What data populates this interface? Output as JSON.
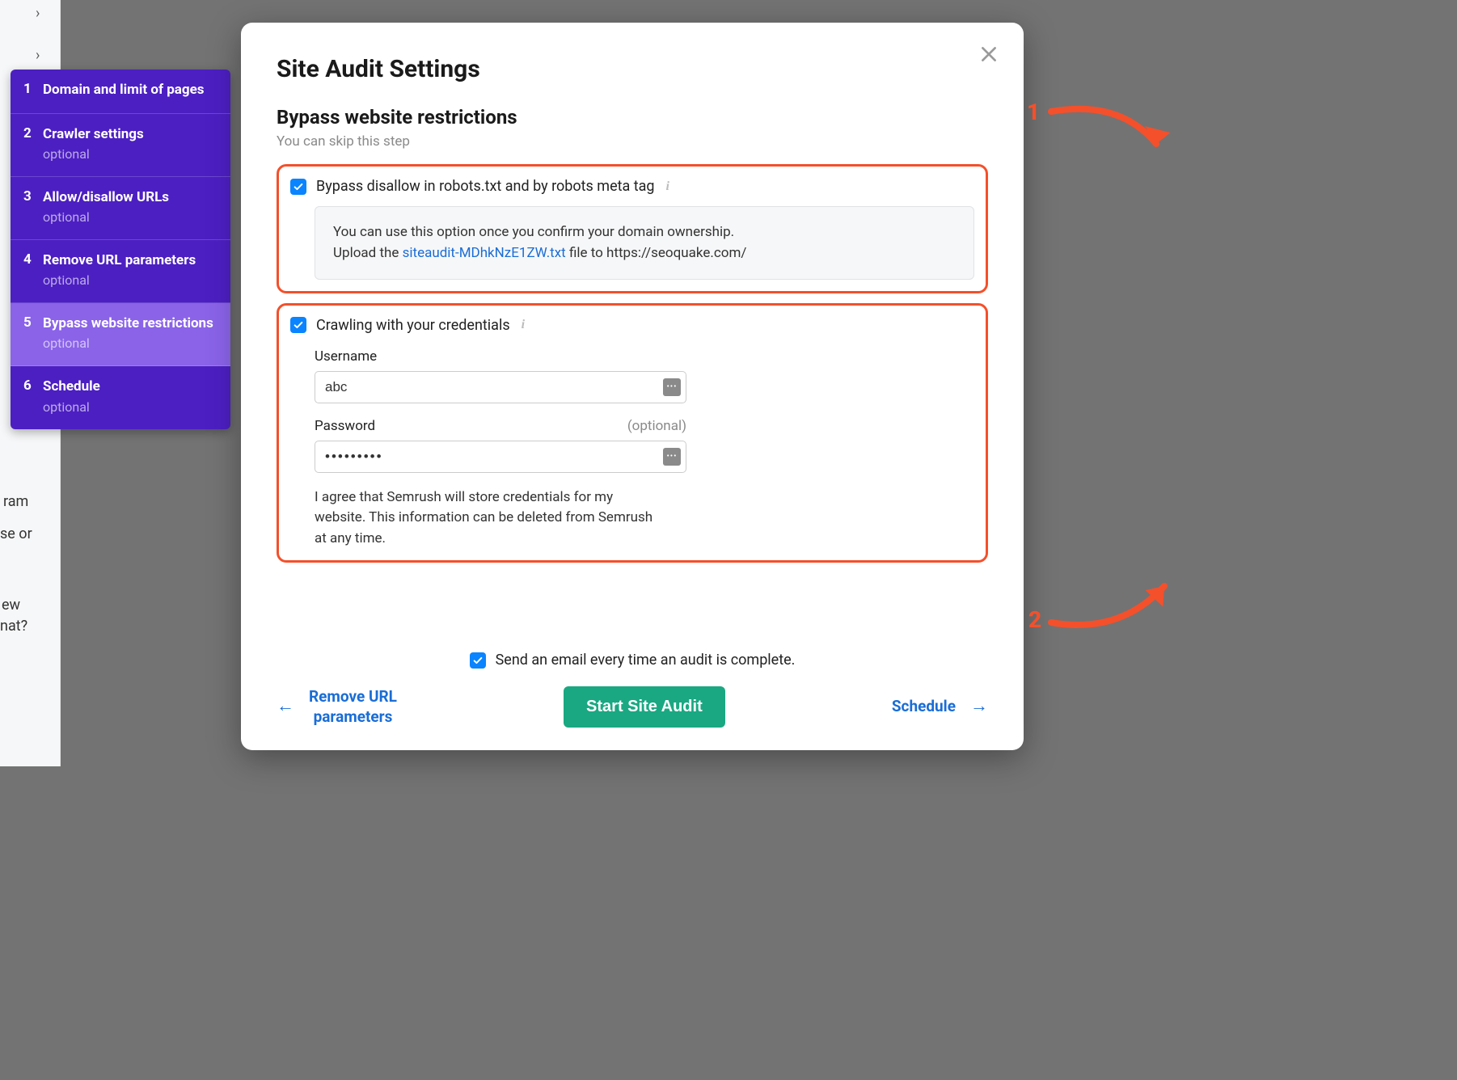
{
  "sidebar": {
    "items": [
      {
        "num": "1",
        "label": "Domain and limit of pages",
        "optional": ""
      },
      {
        "num": "2",
        "label": "Crawler settings",
        "optional": "optional"
      },
      {
        "num": "3",
        "label": "Allow/disallow URLs",
        "optional": "optional"
      },
      {
        "num": "4",
        "label": "Remove URL parameters",
        "optional": "optional"
      },
      {
        "num": "5",
        "label": "Bypass website restrictions",
        "optional": "optional"
      },
      {
        "num": "6",
        "label": "Schedule",
        "optional": "optional"
      }
    ]
  },
  "modal": {
    "title": "Site Audit Settings",
    "section_title": "Bypass website restrictions",
    "section_sub": "You can skip this step",
    "bypass": {
      "label": "Bypass disallow in robots.txt and by robots meta tag",
      "info_line1": "You can use this option once you confirm your domain ownership.",
      "info_prefix": "Upload the ",
      "info_link": "siteaudit-MDhkNzE1ZW.txt",
      "info_suffix": " file to https://seoquake.com/"
    },
    "creds": {
      "label": "Crawling with your credentials",
      "username_label": "Username",
      "username_value": "abc",
      "password_label": "Password",
      "password_optional": "(optional)",
      "password_value": "•••••••••",
      "agree": "I agree that Semrush will store credentials for my website. This information can be deleted from Semrush at any time."
    },
    "email_label": "Send an email every time an audit is complete.",
    "nav_prev": "Remove URL\nparameters",
    "nav_next": "Schedule",
    "start": "Start Site Audit"
  },
  "callouts": {
    "one": "1",
    "two": "2"
  },
  "bg": {
    "t1": "ram",
    "t2": "se or",
    "t3": "ew",
    "t4": "nat?"
  }
}
